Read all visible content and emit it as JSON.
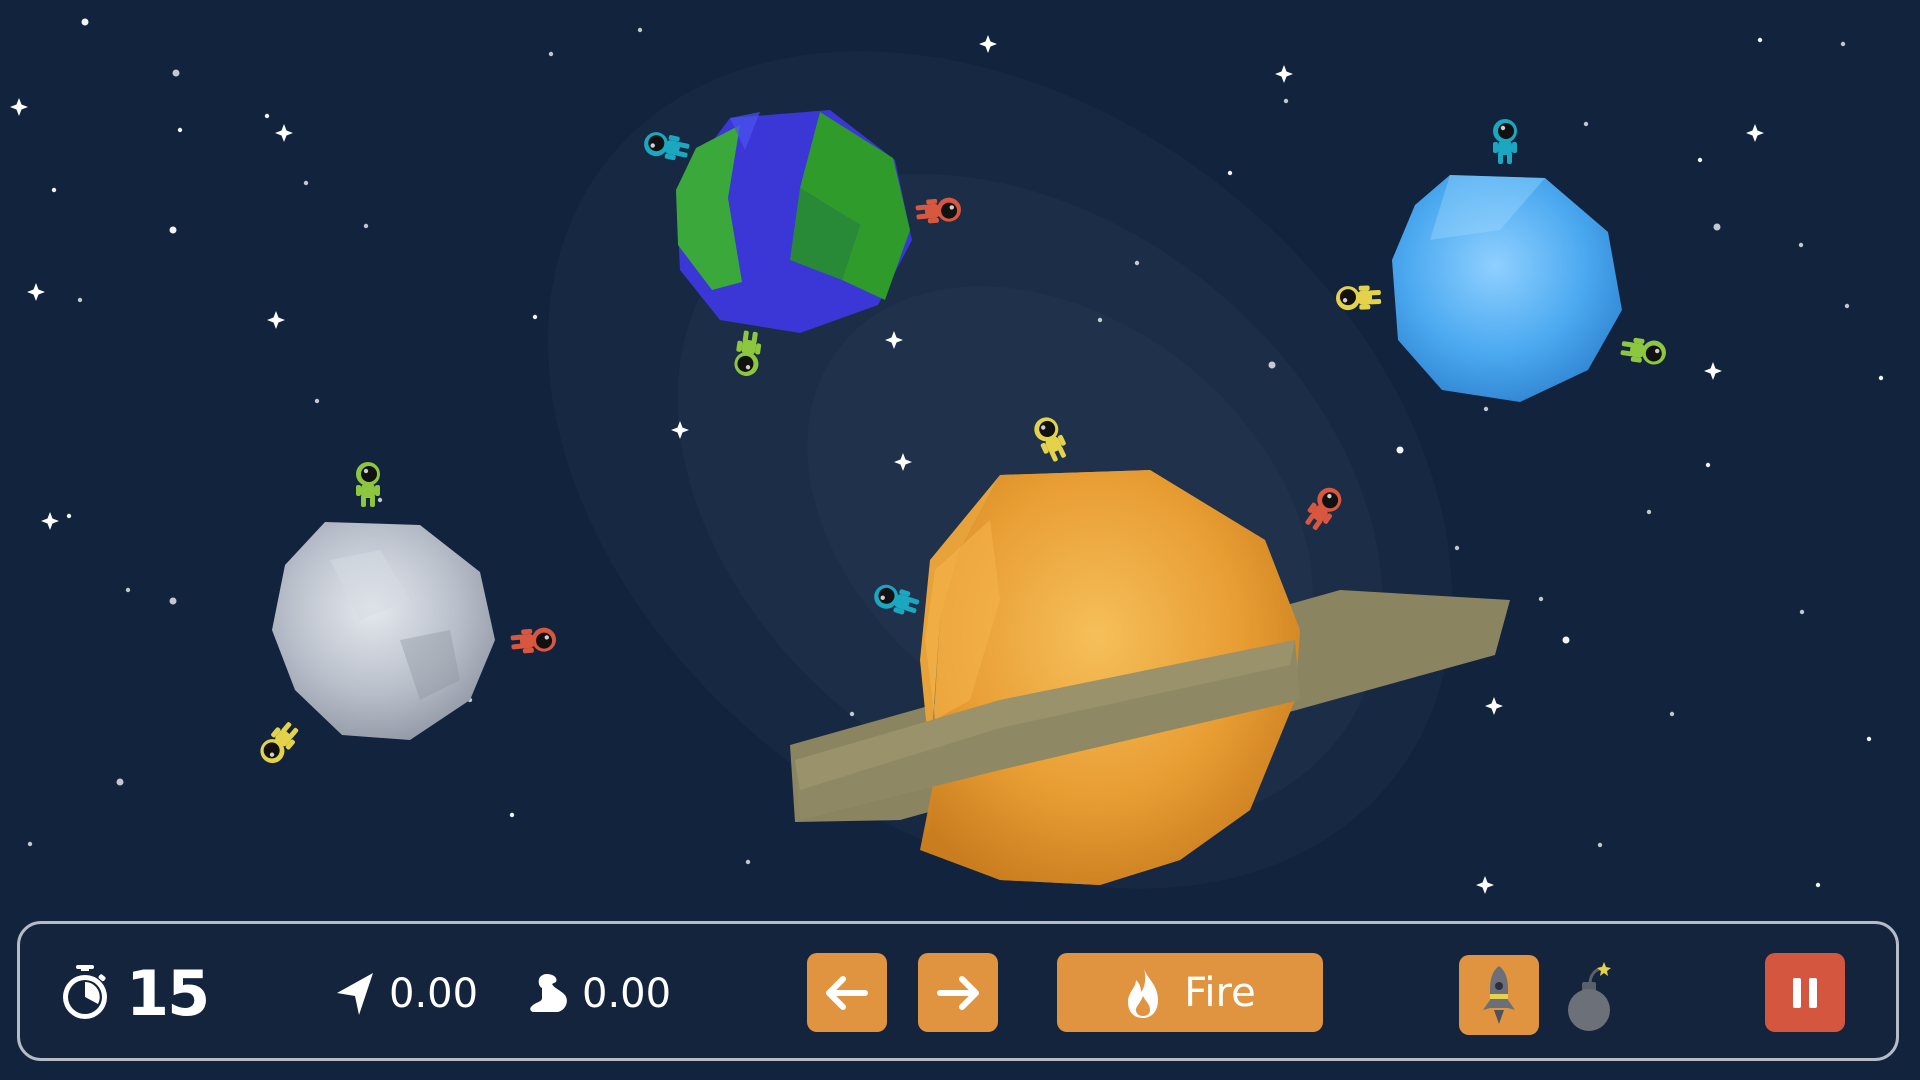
{
  "hud": {
    "timer": {
      "value": "15",
      "icon": "stopwatch-icon"
    },
    "angle": {
      "value": "0.00",
      "icon": "direction-arrow-icon"
    },
    "power": {
      "value": "0.00",
      "icon": "flexed-arm-icon"
    },
    "controls": {
      "rotate_left_icon": "arrow-left-icon",
      "rotate_right_icon": "arrow-right-icon",
      "fire_label": "Fire",
      "fire_icon": "flame-icon",
      "weapon_rocket_icon": "rocket-icon",
      "weapon_bomb_icon": "bomb-icon",
      "pause_icon": "pause-icon"
    }
  },
  "colors": {
    "background": "#12233d",
    "button_orange": "#e09440",
    "pause_red": "#d4563f",
    "hud_border": "#b5bcc6",
    "astronaut_cyan": "#1aa7bf",
    "astronaut_red": "#d9573e",
    "astronaut_yellow": "#e3d24a",
    "astronaut_green": "#8dc63f"
  },
  "scene": {
    "planets": [
      {
        "name": "earth-planet",
        "color": "#3b36d6",
        "accent": "#35a62e"
      },
      {
        "name": "ice-planet",
        "color": "#4aa9f0"
      },
      {
        "name": "moon-planet",
        "color": "#b9c0cc"
      },
      {
        "name": "ringed-planet",
        "color": "#e8a23a",
        "ring_color": "#8a8460"
      }
    ],
    "astronauts": [
      {
        "team": "cyan",
        "planet": "earth-planet"
      },
      {
        "team": "red",
        "planet": "earth-planet"
      },
      {
        "team": "green",
        "planet": "earth-planet"
      },
      {
        "team": "cyan",
        "planet": "ice-planet"
      },
      {
        "team": "yellow",
        "planet": "ice-planet"
      },
      {
        "team": "green",
        "planet": "ice-planet"
      },
      {
        "team": "green",
        "planet": "moon-planet"
      },
      {
        "team": "red",
        "planet": "moon-planet"
      },
      {
        "team": "yellow",
        "planet": "moon-planet"
      },
      {
        "team": "yellow",
        "planet": "ringed-planet"
      },
      {
        "team": "red",
        "planet": "ringed-planet"
      },
      {
        "team": "cyan",
        "planet": "ringed-planet"
      }
    ]
  }
}
